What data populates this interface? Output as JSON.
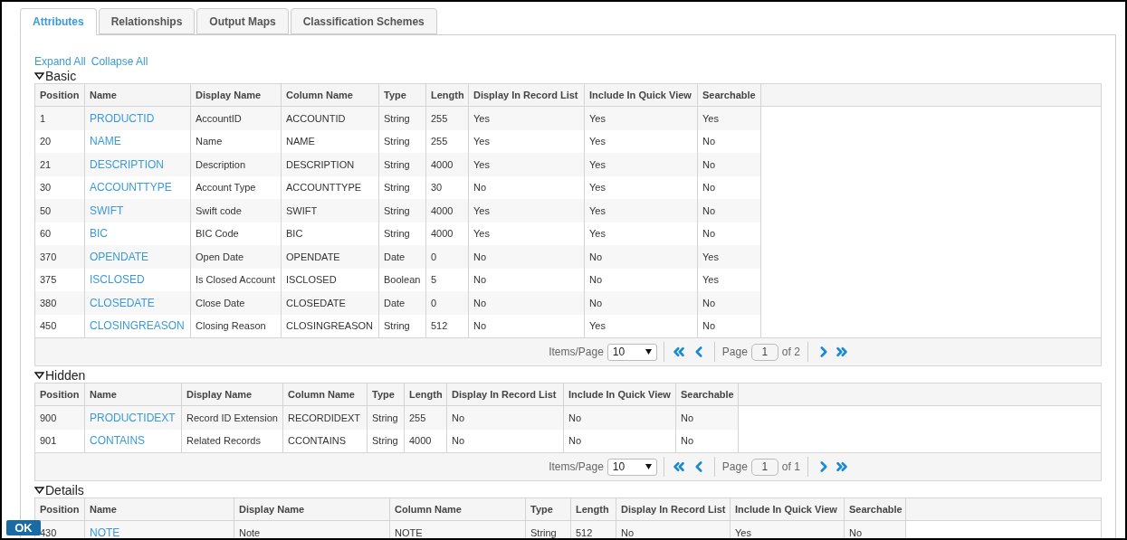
{
  "tabs": [
    {
      "label": "Attributes",
      "selected": true
    },
    {
      "label": "Relationships",
      "selected": false
    },
    {
      "label": "Output Maps",
      "selected": false
    },
    {
      "label": "Classification Schemes",
      "selected": false
    }
  ],
  "links": [
    "Expand All",
    "Collapse All"
  ],
  "sections": [
    {
      "title": "Basic",
      "expanded": true,
      "columns": [
        "Position",
        "Name",
        "Display Name",
        "Column Name",
        "Type",
        "Length",
        "Display In Record List",
        "Include In Quick View",
        "Searchable"
      ],
      "rows": [
        [
          "1",
          "PRODUCTID",
          "AccountID",
          "ACCOUNTID",
          "String",
          "255",
          "Yes",
          "Yes",
          "Yes"
        ],
        [
          "20",
          "NAME",
          "Name",
          "NAME",
          "String",
          "255",
          "Yes",
          "Yes",
          "No"
        ],
        [
          "21",
          "DESCRIPTION",
          "Description",
          "DESCRIPTION",
          "String",
          "4000",
          "Yes",
          "Yes",
          "No"
        ],
        [
          "30",
          "ACCOUNTTYPE",
          "Account Type",
          "ACCOUNTTYPE",
          "String",
          "30",
          "No",
          "Yes",
          "No"
        ],
        [
          "50",
          "SWIFT",
          "Swift code",
          "SWIFT",
          "String",
          "4000",
          "Yes",
          "Yes",
          "No"
        ],
        [
          "60",
          "BIC",
          "BIC Code",
          "BIC",
          "String",
          "4000",
          "Yes",
          "Yes",
          "No"
        ],
        [
          "370",
          "OPENDATE",
          "Open Date",
          "OPENDATE",
          "Date",
          "0",
          "No",
          "No",
          "Yes"
        ],
        [
          "375",
          "ISCLOSED",
          "Is Closed Account",
          "ISCLOSED",
          "Boolean",
          "5",
          "No",
          "No",
          "Yes"
        ],
        [
          "380",
          "CLOSEDATE",
          "Close Date",
          "CLOSEDATE",
          "Date",
          "0",
          "No",
          "No",
          "No"
        ],
        [
          "450",
          "CLOSINGREASON",
          "Closing Reason",
          "CLOSINGREASON",
          "String",
          "512",
          "No",
          "Yes",
          "No"
        ]
      ],
      "pager": {
        "items_label": "Items/Page",
        "items_per_page": "10",
        "page_label": "Page",
        "page": "1",
        "of": "of 2"
      }
    },
    {
      "title": "Hidden",
      "expanded": true,
      "columns": [
        "Position",
        "Name",
        "Display Name",
        "Column Name",
        "Type",
        "Length",
        "Display In Record List",
        "Include In Quick View",
        "Searchable"
      ],
      "rows": [
        [
          "900",
          "PRODUCTIDEXT",
          "Record ID Extension",
          "RECORDIDEXT",
          "String",
          "255",
          "No",
          "No",
          "No"
        ],
        [
          "901",
          "CONTAINS",
          "Related Records",
          "CCONTAINS",
          "String",
          "4000",
          "No",
          "No",
          "No"
        ]
      ],
      "pager": {
        "items_label": "Items/Page",
        "items_per_page": "10",
        "page_label": "Page",
        "page": "1",
        "of": "of 1"
      }
    },
    {
      "title": "Details",
      "expanded": true,
      "columns": [
        "Position",
        "Name",
        "Display Name",
        "Column Name",
        "Type",
        "Length",
        "Display In Record List",
        "Include In Quick View",
        "Searchable"
      ],
      "rows": [
        [
          "430",
          "NOTE",
          "Note",
          "NOTE",
          "String",
          "512",
          "No",
          "Yes",
          "No"
        ]
      ]
    }
  ],
  "ok_button": "OK"
}
